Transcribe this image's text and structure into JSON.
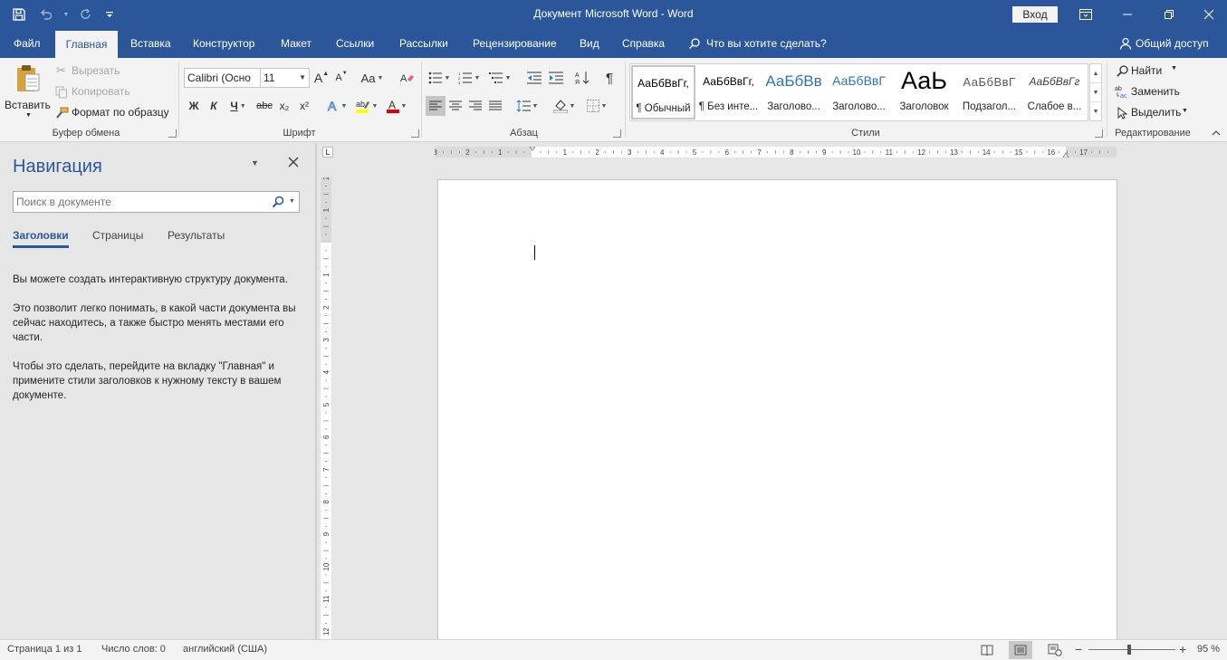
{
  "window": {
    "title": "Документ Microsoft Word  -  Word",
    "signin": "Вход"
  },
  "tabs": {
    "items": [
      "Файл",
      "Главная",
      "Вставка",
      "Конструктор",
      "Макет",
      "Ссылки",
      "Рассылки",
      "Рецензирование",
      "Вид",
      "Справка"
    ],
    "active": "Главная",
    "tell_me": "Что вы хотите сделать?",
    "share": "Общий доступ"
  },
  "clipboard": {
    "paste": "Вставить",
    "cut": "Вырезать",
    "copy": "Копировать",
    "format_painter": "Формат по образцу",
    "label": "Буфер обмена"
  },
  "font": {
    "name": "Calibri (Осно",
    "size": "11",
    "label": "Шрифт",
    "bold": "Ж",
    "italic": "К",
    "underline": "Ч",
    "strike": "abc",
    "sub": "x₂",
    "sup": "x²",
    "case": "Aa",
    "grow": "A",
    "shrink": "A"
  },
  "paragraph": {
    "label": "Абзац",
    "pilcrow": "¶"
  },
  "styles": {
    "label": "Стили",
    "items": [
      {
        "preview": "АаБбВвГг,",
        "name": "¶ Обычный",
        "color": "#000000",
        "size": "12px"
      },
      {
        "preview": "АаБбВвГг,",
        "name": "¶ Без инте...",
        "color": "#000000",
        "size": "12px"
      },
      {
        "preview": "АаБбВв",
        "name": "Заголово...",
        "color": "#2e74b5",
        "size": "17px"
      },
      {
        "preview": "АаБбВвГ",
        "name": "Заголово...",
        "color": "#2e74b5",
        "size": "14px"
      },
      {
        "preview": "АаЬ",
        "name": "Заголовок",
        "color": "#000000",
        "size": "27px"
      },
      {
        "preview": "АаБбВвГ",
        "name": "Подзагол...",
        "color": "#595959",
        "size": "13px"
      },
      {
        "preview": "АаБбВвГг",
        "name": "Слабое в...",
        "color": "#404040",
        "size": "12px"
      }
    ]
  },
  "editing": {
    "find": "Найти",
    "replace": "Заменить",
    "select": "Выделить",
    "label": "Редактирование"
  },
  "nav": {
    "title": "Навигация",
    "search_placeholder": "Поиск в документе",
    "tabs": [
      "Заголовки",
      "Страницы",
      "Результаты"
    ],
    "p1": "Вы можете создать интерактивную структуру документа.",
    "p2": "Это позволит легко понимать, в какой части документа вы сейчас находитесь, а также быстро менять местами его части.",
    "p3": "Чтобы это сделать, перейдите на вкладку \"Главная\" и примените стили заголовков к нужному тексту в вашем документе."
  },
  "ruler": {
    "h_labels": [
      "3",
      "2",
      "1",
      "",
      "1",
      "2",
      "3",
      "4",
      "5",
      "6",
      "7",
      "8",
      "9",
      "10",
      "11",
      "12",
      "13",
      "14",
      "15",
      "16",
      "17"
    ],
    "v_labels": [
      "2",
      "1",
      "",
      "1",
      "2",
      "3",
      "4",
      "5",
      "6",
      "7",
      "8",
      "9",
      "10",
      "11",
      "12"
    ],
    "corner": "L"
  },
  "status": {
    "page": "Страница 1 из 1",
    "words": "Число слов: 0",
    "language": "английский (США)",
    "zoom": "95 %",
    "zoom_minus": "−",
    "zoom_plus": "+"
  }
}
